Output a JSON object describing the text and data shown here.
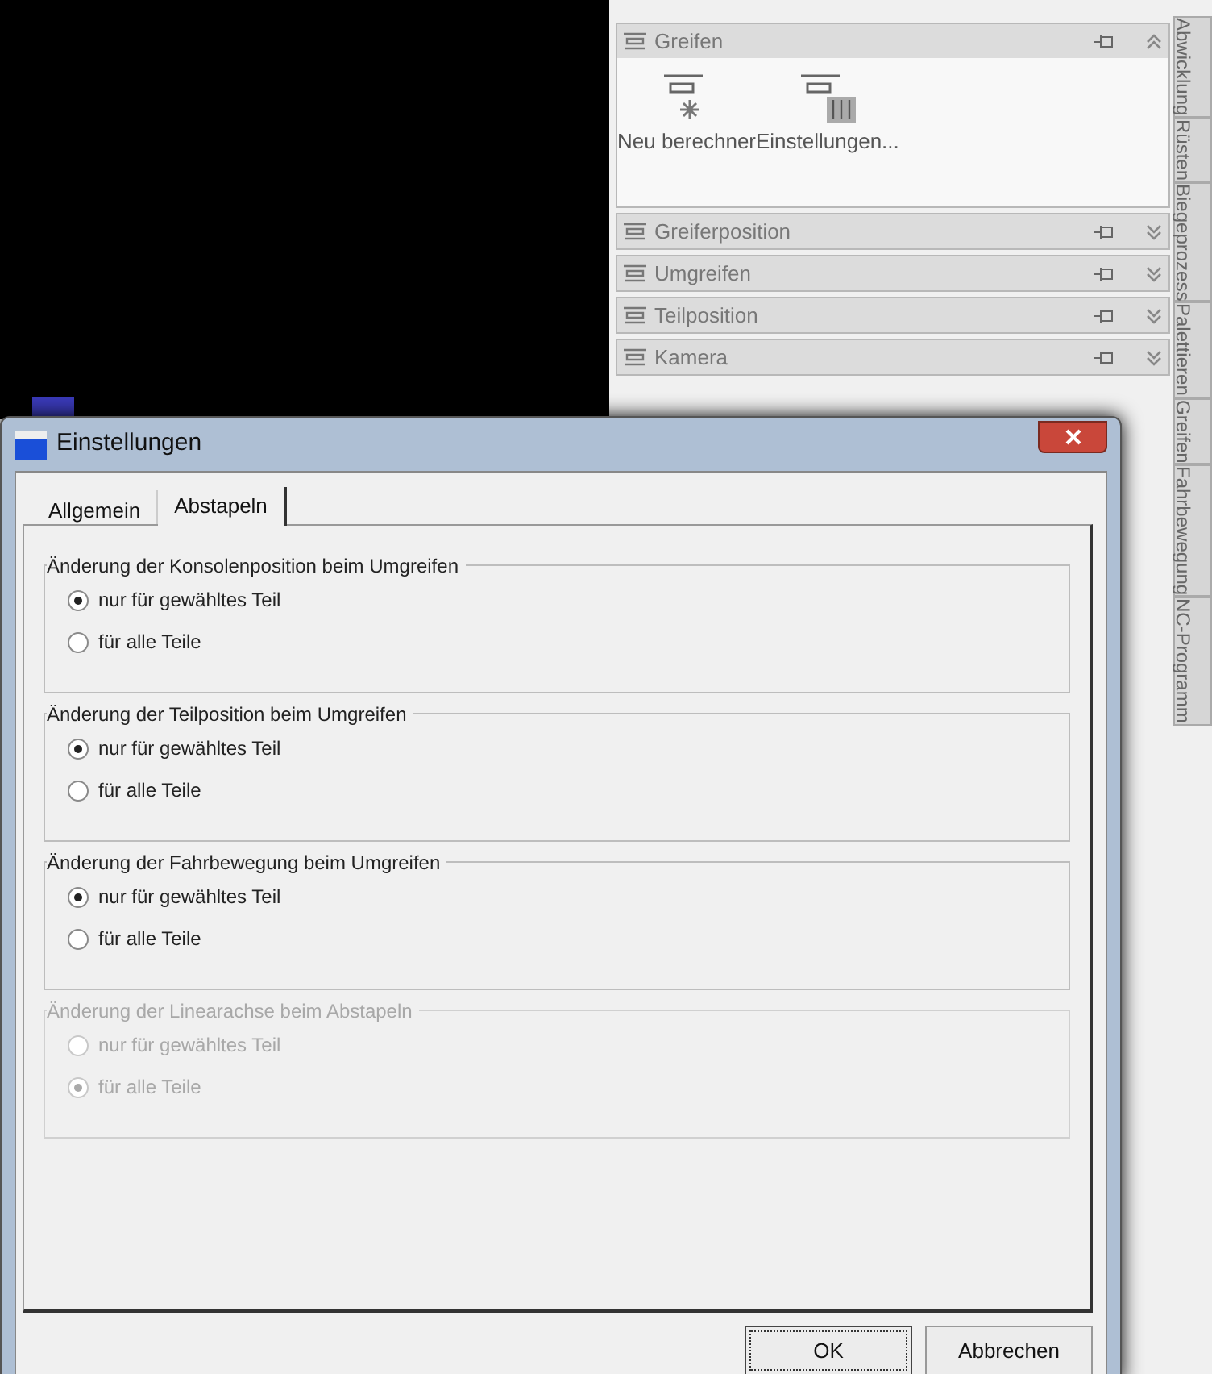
{
  "panel": {
    "sections": [
      {
        "title": "Greifen",
        "expanded": true,
        "actions": [
          {
            "label": "Neu berechner",
            "kind": "recalc"
          },
          {
            "label": "Einstellungen...",
            "kind": "settings"
          }
        ]
      },
      {
        "title": "Greiferposition",
        "expanded": false
      },
      {
        "title": "Umgreifen",
        "expanded": false
      },
      {
        "title": "Teilposition",
        "expanded": false
      },
      {
        "title": "Kamera",
        "expanded": false
      }
    ]
  },
  "side_tabs": [
    {
      "label": "Abwicklung"
    },
    {
      "label": "Rüsten"
    },
    {
      "label": "Biegeprozess"
    },
    {
      "label": "Palettieren"
    },
    {
      "label": "Greifen"
    },
    {
      "label": "Fahrbewegung"
    },
    {
      "label": "NC-Programm"
    }
  ],
  "dialog": {
    "title": "Einstellungen",
    "tabs": [
      {
        "label": "Allgemein",
        "selected": false
      },
      {
        "label": "Abstapeln",
        "selected": true
      }
    ],
    "groups": [
      {
        "title": "Änderung der Konsolenposition beim Umgreifen",
        "disabled": false,
        "options": [
          {
            "label": "nur für gewähltes Teil",
            "selected": true
          },
          {
            "label": "für alle Teile",
            "selected": false
          }
        ]
      },
      {
        "title": "Änderung der Teilposition beim Umgreifen",
        "disabled": false,
        "options": [
          {
            "label": "nur für gewähltes Teil",
            "selected": true
          },
          {
            "label": "für alle Teile",
            "selected": false
          }
        ]
      },
      {
        "title": "Änderung der Fahrbewegung beim Umgreifen",
        "disabled": false,
        "options": [
          {
            "label": "nur für gewähltes Teil",
            "selected": true
          },
          {
            "label": "für alle Teile",
            "selected": false
          }
        ]
      },
      {
        "title": "Änderung der Linearachse beim Abstapeln",
        "disabled": true,
        "options": [
          {
            "label": "nur für gewähltes Teil",
            "selected": false
          },
          {
            "label": "für alle Teile",
            "selected": true
          }
        ]
      }
    ],
    "buttons": [
      {
        "label": "OK",
        "default": true
      },
      {
        "label": "Abbrechen",
        "default": false
      }
    ]
  }
}
